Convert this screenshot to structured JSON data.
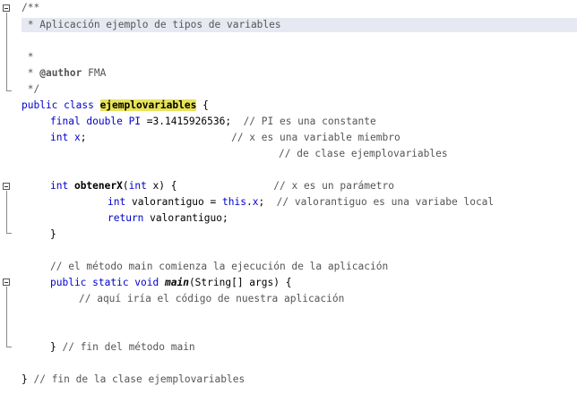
{
  "code": {
    "l1": "/**",
    "l2": " * Aplicación ejemplo de tipos de variables",
    "l3": " *",
    "l4a": " * ",
    "l4_tag": "@author",
    "l4b": " FMA",
    "l5": " */",
    "l6_kw": "public class ",
    "l6_name": "ejemplovariables",
    "l6_end": " {",
    "l7_kw": "final double ",
    "l7_var": "PI",
    "l7_val": " =3.1415926536;  ",
    "l7_cm": "// PI es una constante",
    "l8_kw": "int ",
    "l8_var": "x",
    "l8_end": ";                        ",
    "l8_cm": "// x es una variable miembro",
    "l9_cm": "// de clase ejemplovariables",
    "l10_kw": "int ",
    "l10_name": "obtenerX",
    "l10_p1": "(",
    "l10_kw2": "int",
    "l10_p2": " x) {                ",
    "l10_cm": "// x es un parámetro",
    "l11_kw": "int ",
    "l11_mid": "valorantiguo = ",
    "l11_this": "this",
    "l11_dot": ".",
    "l11_x": "x",
    "l11_end": ";  ",
    "l11_cm": "// valorantiguo es una variabe local",
    "l12_kw": "return ",
    "l12_end": "valorantiguo;",
    "l13": "}",
    "l14_cm": "// el método main comienza la ejecución de la aplicación",
    "l15_kw": "public static void ",
    "l15_name": "main",
    "l15_end": "(String[] args) {",
    "l16_cm": "// aquí iría el código de nuestra aplicación",
    "l17a": "} ",
    "l17_cm": "// fin del método main",
    "l18a": "} ",
    "l18_cm": "// fin de la clase ejemplovariables"
  },
  "colors": {
    "keyword": "#0000cc",
    "comment": "#555555",
    "highlight_line": "#e6e9f2",
    "selection_mark": "#e8e35a"
  },
  "icons": [
    "fold-collapse-icon"
  ]
}
